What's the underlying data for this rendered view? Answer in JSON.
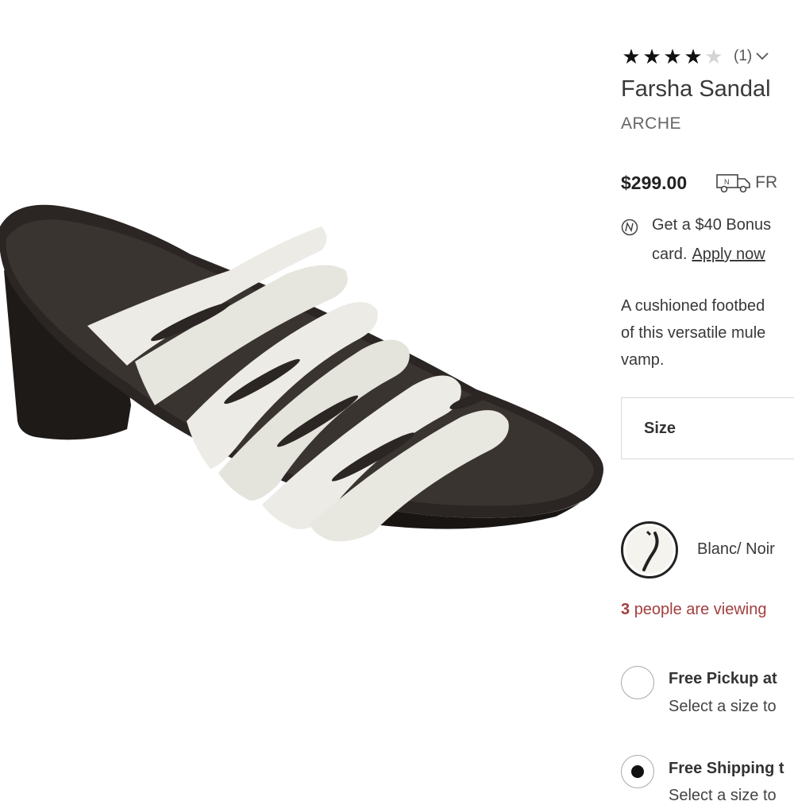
{
  "product": {
    "rating_stars": 4,
    "rating_max": 5,
    "review_count": "(1)",
    "title": "Farsha Sandal",
    "brand": "ARCHE",
    "price": "$299.00",
    "shipping_text": "FR",
    "bonus_line1": "Get a $40 Bonus",
    "bonus_line2_prefix": "card.",
    "bonus_link": "Apply now",
    "description_lines": [
      "A cushioned footbed",
      "of this versatile mule",
      "vamp."
    ],
    "size_label": "Size",
    "color_name": "Blanc/ Noir",
    "viewing_count": "3",
    "viewing_text": "people are viewing"
  },
  "delivery": {
    "pickup_title": "Free Pickup at",
    "pickup_sub": "Select a size to",
    "shipping_title": "Free Shipping t",
    "shipping_sub": "Select a size to"
  },
  "icons": {
    "star": "star-icon",
    "chevron": "chevron-down-icon",
    "truck": "truck-icon",
    "nordstrom": "nordstrom-logo-icon"
  },
  "colors": {
    "sale_text": "#a33e3e",
    "text": "#393939"
  }
}
